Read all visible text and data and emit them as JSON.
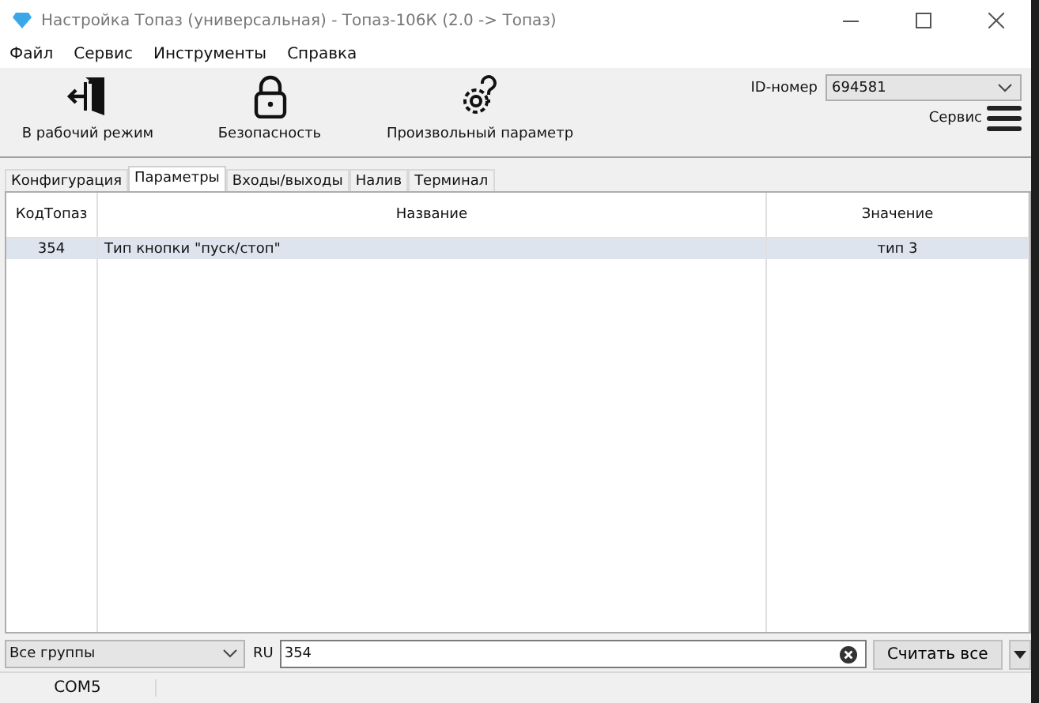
{
  "window": {
    "title": "Настройка Топаз (универсальная) - Топаз-106К (2.0 -> Топаз)"
  },
  "menu": [
    "Файл",
    "Сервис",
    "Инструменты",
    "Справка"
  ],
  "toolbar": [
    {
      "kind": "exit",
      "label": "В рабочий режим"
    },
    {
      "kind": "lock",
      "label": "Безопасность"
    },
    {
      "kind": "gear",
      "label": "Произвольный параметр"
    }
  ],
  "id_field": {
    "label": "ID-номер",
    "value": "694581"
  },
  "service": {
    "label": "Сервис"
  },
  "tabs": [
    {
      "label": "Конфигурация",
      "selected": false
    },
    {
      "label": "Параметры",
      "selected": true
    },
    {
      "label": "Входы/выходы",
      "selected": false
    },
    {
      "label": "Налив",
      "selected": false
    },
    {
      "label": "Терминал",
      "selected": false
    }
  ],
  "table": {
    "columns": [
      "КодТопаз",
      "Название",
      "Значение"
    ],
    "rows": [
      {
        "cells": [
          "354",
          "Тип кнопки \"пуск/стоп\"",
          "тип 3"
        ],
        "selected": true
      }
    ]
  },
  "bottom": {
    "group": "Все группы",
    "lang": "RU",
    "search": "354",
    "button": "Считать все"
  },
  "status_bar": [
    "COM5"
  ]
}
